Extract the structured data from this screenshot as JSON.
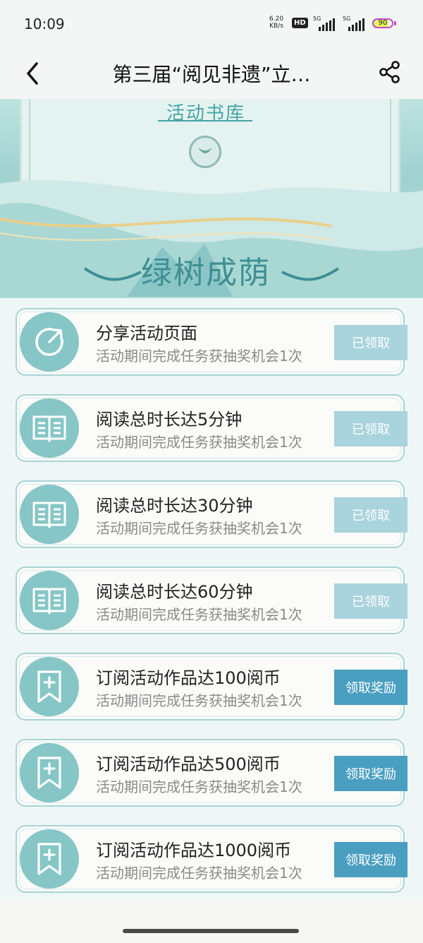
{
  "status_bar": {
    "time": "10:09",
    "net_speed_value": "6.20",
    "net_speed_unit": "KB/s",
    "hd_badge": "HD",
    "signal1_label": "5G",
    "signal2_label": "5G",
    "battery_level": "90",
    "battery_color": "#c04ac8"
  },
  "navbar": {
    "back_icon": "chevron-left-icon",
    "title": "第三届“阅见非遗”立…",
    "share_icon": "share-icon"
  },
  "banner": {
    "library_label": "活动书库",
    "section_title": "绿树成荫"
  },
  "tasks": [
    {
      "icon": "share-arrow-icon",
      "title": "分享活动页面",
      "desc": "活动期间完成任务获抽奖机会1次",
      "button": "已领取",
      "state": "claimed"
    },
    {
      "icon": "book-icon",
      "title": "阅读总时长达5分钟",
      "desc": "活动期间完成任务获抽奖机会1次",
      "button": "已领取",
      "state": "claimed"
    },
    {
      "icon": "book-icon",
      "title": "阅读总时长达30分钟",
      "desc": "活动期间完成任务获抽奖机会1次",
      "button": "已领取",
      "state": "claimed"
    },
    {
      "icon": "book-icon",
      "title": "阅读总时长达60分钟",
      "desc": "活动期间完成任务获抽奖机会1次",
      "button": "已领取",
      "state": "claimed"
    },
    {
      "icon": "bookmark-plus-icon",
      "title": "订阅活动作品达100阅币",
      "desc": "活动期间完成任务获抽奖机会1次",
      "button": "领取奖励",
      "state": "active"
    },
    {
      "icon": "bookmark-plus-icon",
      "title": "订阅活动作品达500阅币",
      "desc": "活动期间完成任务获抽奖机会1次",
      "button": "领取奖励",
      "state": "active"
    },
    {
      "icon": "bookmark-plus-icon",
      "title": "订阅活动作品达1000阅币",
      "desc": "活动期间完成任务获抽奖机会1次",
      "button": "领取奖励",
      "state": "active"
    }
  ],
  "colors": {
    "accent": "#4a9fc1",
    "claimed": "#a9d3dd",
    "icon_bg": "#86c6c6",
    "card_border": "#a9d4d6"
  }
}
